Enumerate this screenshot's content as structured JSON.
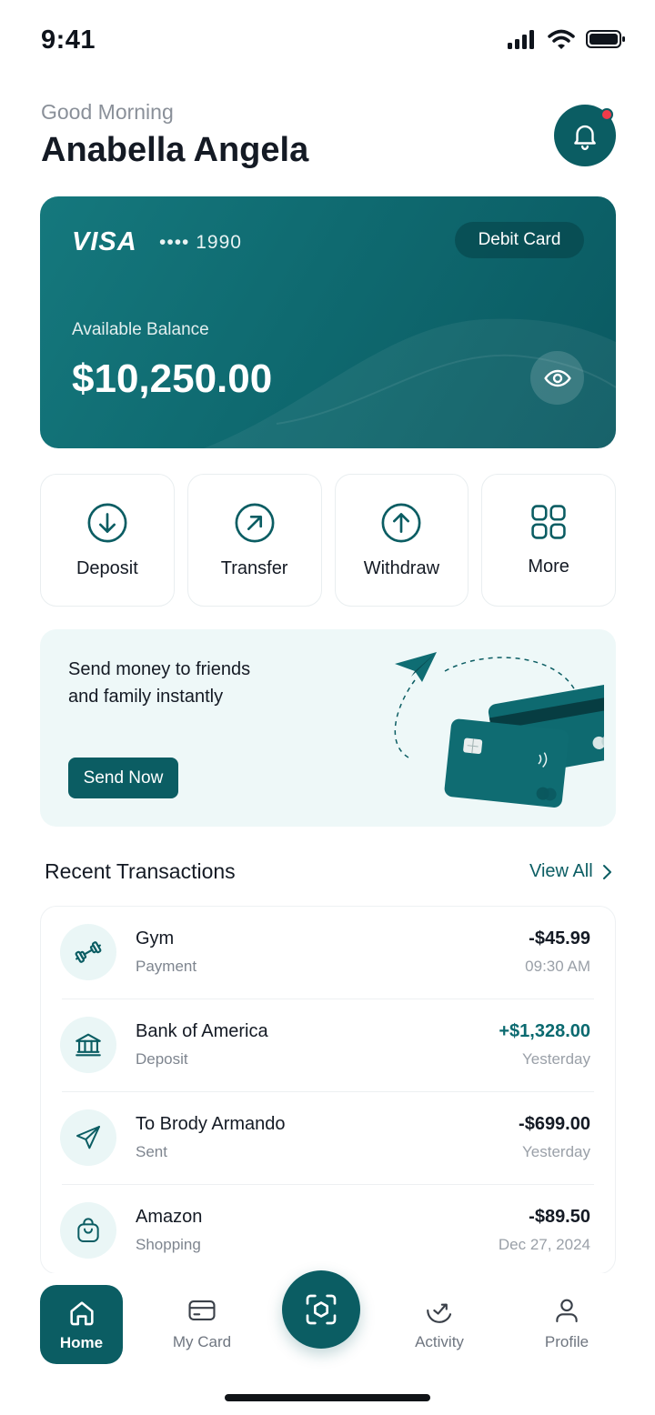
{
  "status_bar": {
    "time": "9:41"
  },
  "header": {
    "greeting": "Good Morning",
    "name": "Anabella Angela"
  },
  "card": {
    "brand": "VISA",
    "number": "•••• 1990",
    "type": "Debit Card",
    "balance_label": "Available Balance",
    "balance": "$10,250.00"
  },
  "actions": [
    {
      "label": "Deposit",
      "icon": "arrow-down-circle-icon"
    },
    {
      "label": "Transfer",
      "icon": "arrow-up-right-circle-icon"
    },
    {
      "label": "Withdraw",
      "icon": "arrow-up-circle-icon"
    },
    {
      "label": "More",
      "icon": "grid-icon"
    }
  ],
  "promo": {
    "text": "Send money to friends and family instantly",
    "button": "Send Now"
  },
  "transactions": {
    "title": "Recent Transactions",
    "view_all": "View All",
    "items": [
      {
        "name": "Gym",
        "category": "Payment",
        "amount": "-$45.99",
        "time": "09:30 AM",
        "icon": "dumbbell-icon"
      },
      {
        "name": "Bank of America",
        "category": "Deposit",
        "amount": "+$1,328.00",
        "time": "Yesterday",
        "icon": "bank-icon"
      },
      {
        "name": "To Brody Armando",
        "category": "Sent",
        "amount": "-$699.00",
        "time": "Yesterday",
        "icon": "send-icon"
      },
      {
        "name": "Amazon",
        "category": "Shopping",
        "amount": "-$89.50",
        "time": "Dec 27, 2024",
        "icon": "shopping-bag-icon"
      }
    ]
  },
  "nav": {
    "home": "Home",
    "my_card": "My Card",
    "activity": "Activity",
    "profile": "Profile"
  },
  "colors": {
    "primary": "#0b5d63",
    "positive": "#0b6a70",
    "notification": "#ef3b4a",
    "promo_bg": "#eef8f8"
  }
}
